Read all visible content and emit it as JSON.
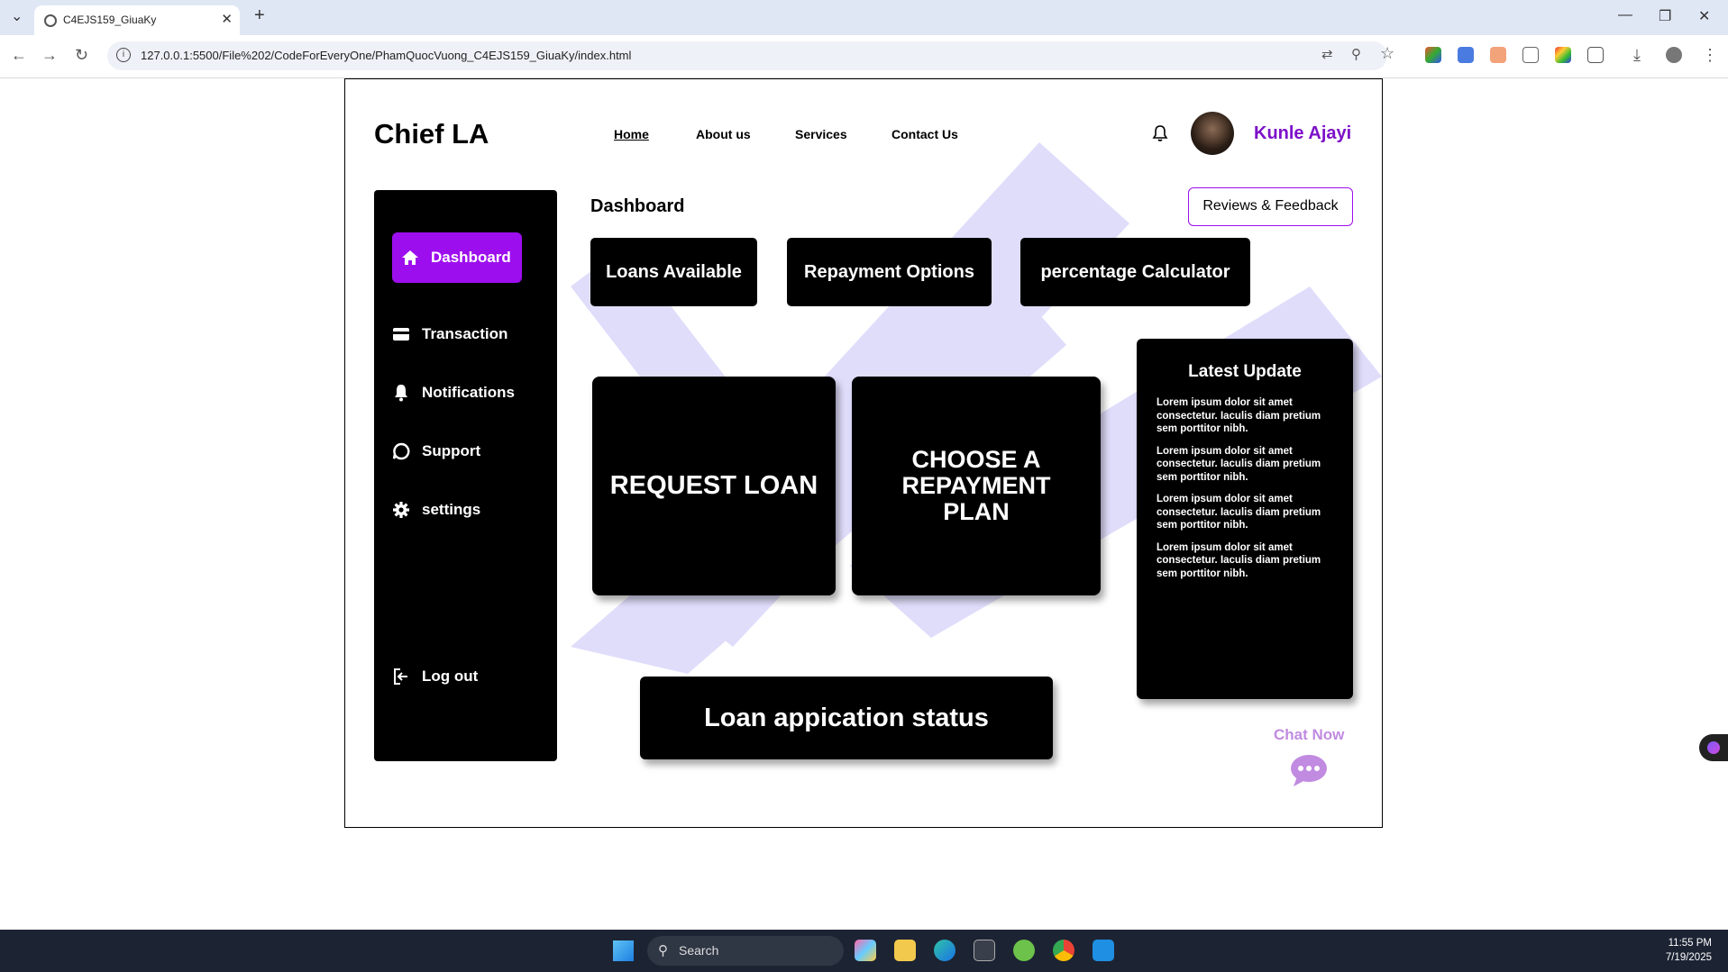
{
  "browser": {
    "tab_title": "C4EJS159_GiuaKy",
    "url": "127.0.0.1:5500/File%202/CodeForEveryOne/PhamQuocVuong_C4EJS159_GiuaKy/index.html"
  },
  "header": {
    "logo": "Chief LA",
    "nav": [
      "Home",
      "About us",
      "Services",
      "Contact Us"
    ],
    "username": "Kunle Ajayi"
  },
  "sidebar": {
    "items": [
      {
        "label": "Dashboard",
        "icon": "home-icon"
      },
      {
        "label": "Transaction",
        "icon": "card-icon"
      },
      {
        "label": "Notifications",
        "icon": "bell-icon"
      },
      {
        "label": "Support",
        "icon": "chat-icon"
      },
      {
        "label": "settings",
        "icon": "gear-icon"
      }
    ],
    "logout": "Log out"
  },
  "main": {
    "title": "Dashboard",
    "reviews_button": "Reviews & Feedback",
    "pills": [
      "Loans Available",
      "Repayment Options",
      "percentage Calculator"
    ],
    "request_loan": "REQUEST LOAN",
    "repayment_plan": "CHOOSE A REPAYMENT PLAN",
    "loan_status": "Loan appication status"
  },
  "latest_update": {
    "title": "Latest Update",
    "items": [
      "Lorem ipsum dolor sit amet consectetur. Iaculis diam pretium sem porttitor nibh.",
      "Lorem ipsum dolor sit amet consectetur. Iaculis diam pretium sem porttitor nibh.",
      "Lorem ipsum dolor sit amet consectetur. Iaculis diam pretium sem porttitor nibh.",
      "Lorem ipsum dolor sit amet consectetur. Iaculis diam pretium sem porttitor nibh."
    ]
  },
  "chat": {
    "label": "Chat Now"
  },
  "taskbar": {
    "search_placeholder": "Search",
    "time": "11:55 PM",
    "date": "7/19/2025"
  },
  "colors": {
    "accent": "#9d0eee",
    "username": "#7d10c9",
    "chat": "#c08be0",
    "decor": "#e0ddfb"
  }
}
